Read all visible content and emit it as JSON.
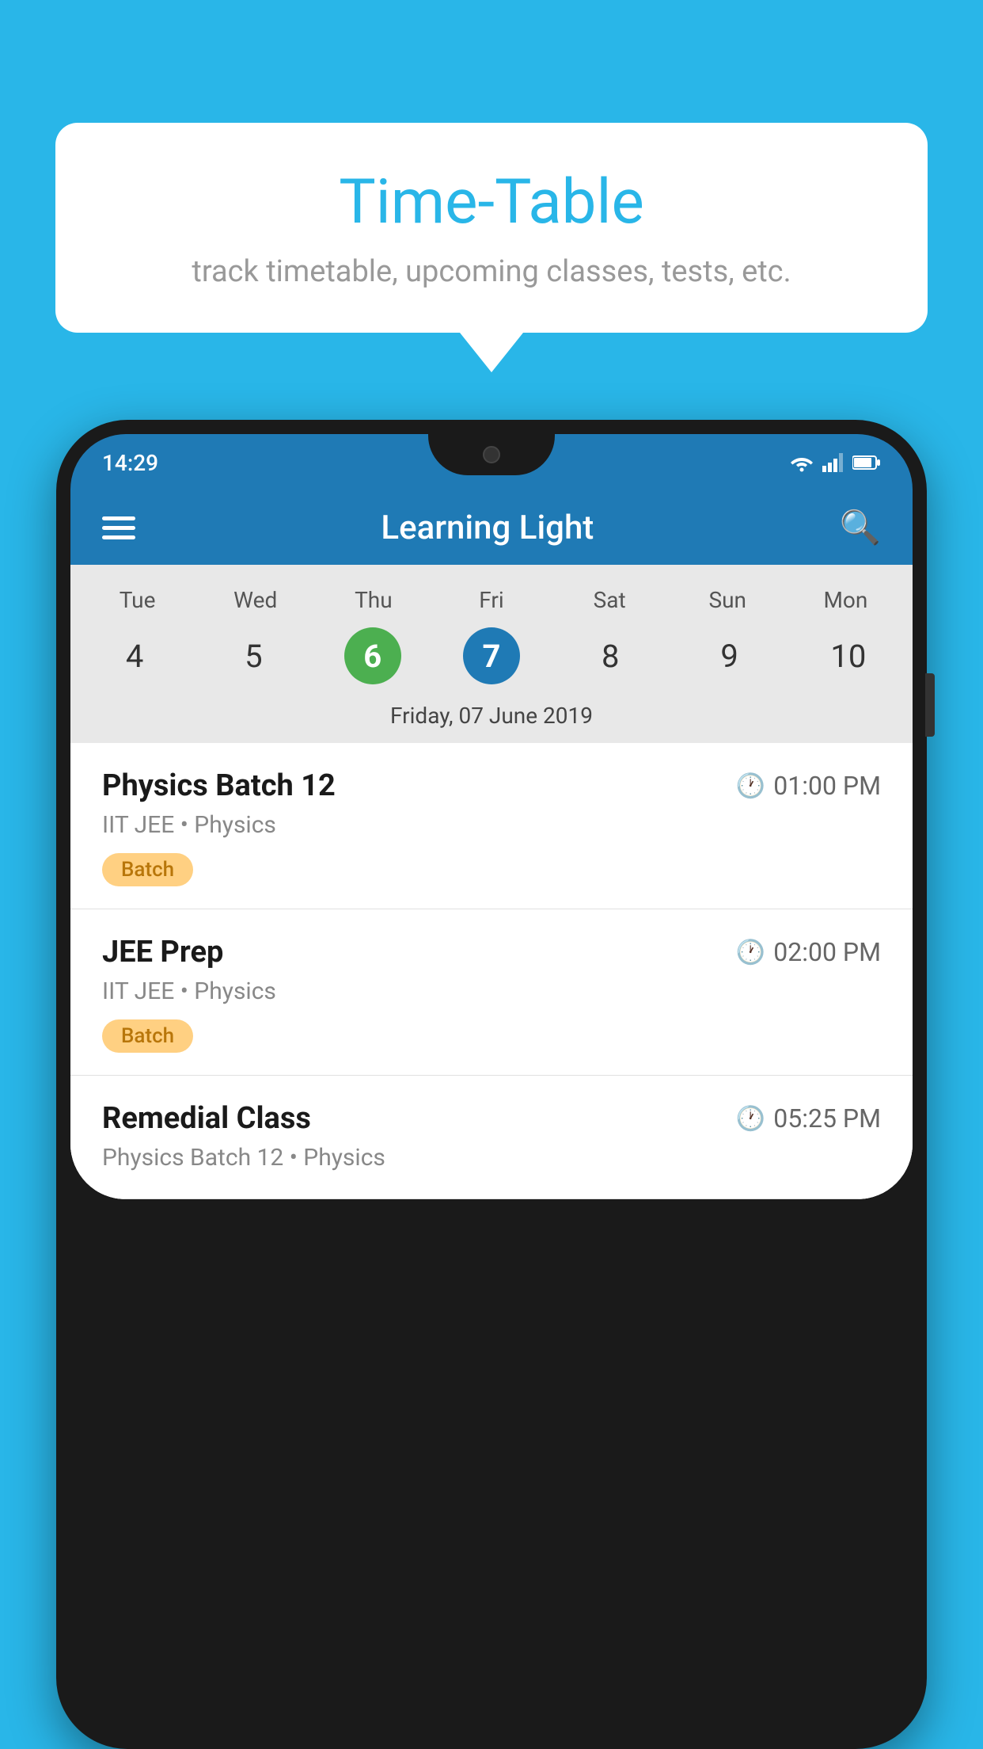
{
  "background_color": "#29b6e8",
  "speech_bubble": {
    "title": "Time-Table",
    "subtitle": "track timetable, upcoming classes, tests, etc."
  },
  "status_bar": {
    "time": "14:29",
    "icons": [
      "wifi",
      "signal",
      "battery"
    ]
  },
  "app_bar": {
    "title": "Learning Light",
    "search_label": "search"
  },
  "calendar": {
    "days": [
      {
        "label": "Tue",
        "num": "4"
      },
      {
        "label": "Wed",
        "num": "5"
      },
      {
        "label": "Thu",
        "num": "6",
        "state": "today"
      },
      {
        "label": "Fri",
        "num": "7",
        "state": "selected"
      },
      {
        "label": "Sat",
        "num": "8"
      },
      {
        "label": "Sun",
        "num": "9"
      },
      {
        "label": "Mon",
        "num": "10"
      }
    ],
    "selected_date_label": "Friday, 07 June 2019"
  },
  "schedule_items": [
    {
      "title": "Physics Batch 12",
      "time": "01:00 PM",
      "subtitle": "IIT JEE • Physics",
      "badge": "Batch"
    },
    {
      "title": "JEE Prep",
      "time": "02:00 PM",
      "subtitle": "IIT JEE • Physics",
      "badge": "Batch"
    },
    {
      "title": "Remedial Class",
      "time": "05:25 PM",
      "subtitle": "Physics Batch 12 • Physics",
      "badge": null
    }
  ]
}
